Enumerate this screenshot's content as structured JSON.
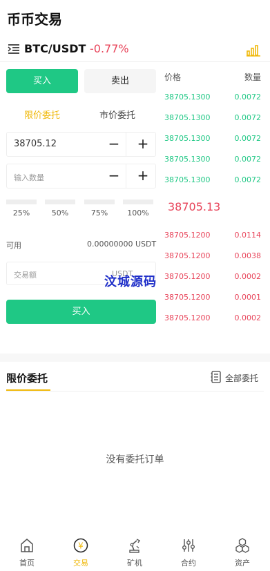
{
  "header": {
    "title": "币币交易"
  },
  "pair": {
    "name": "BTC/USDT",
    "change": "-0.77%",
    "menu_icon": "list-indent-icon",
    "chart_icon": "bar-chart-icon"
  },
  "side_tabs": {
    "buy": "买入",
    "sell": "卖出"
  },
  "order_types": {
    "limit": "限价委托",
    "market": "市价委托"
  },
  "form": {
    "price_value": "38705.12",
    "amount_placeholder": "输入数量",
    "minus": "−",
    "plus": "+",
    "percents": [
      "25%",
      "50%",
      "75%",
      "100%"
    ],
    "available_label": "可用",
    "available_value": "0.00000000 USDT",
    "total_placeholder": "交易额",
    "total_unit": "USDT",
    "submit": "买入"
  },
  "orderbook": {
    "header_price": "价格",
    "header_qty": "数量",
    "bids": [
      {
        "price": "38705.1300",
        "qty": "0.0072"
      },
      {
        "price": "38705.1300",
        "qty": "0.0072"
      },
      {
        "price": "38705.1300",
        "qty": "0.0072"
      },
      {
        "price": "38705.1300",
        "qty": "0.0072"
      },
      {
        "price": "38705.1300",
        "qty": "0.0072"
      }
    ],
    "last_price": "38705.13",
    "asks": [
      {
        "price": "38705.1200",
        "qty": "0.0114"
      },
      {
        "price": "38705.1200",
        "qty": "0.0038"
      },
      {
        "price": "38705.1200",
        "qty": "0.0002"
      },
      {
        "price": "38705.1200",
        "qty": "0.0001"
      },
      {
        "price": "38705.1200",
        "qty": "0.0002"
      }
    ]
  },
  "watermark": "汶城源码",
  "orders": {
    "title": "限价委托",
    "all_label": "全部委托",
    "empty": "没有委托订单"
  },
  "tabbar": [
    {
      "label": "首页",
      "icon": "home-icon"
    },
    {
      "label": "交易",
      "icon": "yuan-coin-icon",
      "active": true
    },
    {
      "label": "矿机",
      "icon": "robot-arm-icon"
    },
    {
      "label": "合约",
      "icon": "sliders-icon"
    },
    {
      "label": "资产",
      "icon": "cubes-icon"
    }
  ],
  "colors": {
    "accent_green": "#1fc885",
    "accent_red": "#e8445a",
    "accent_yellow": "#f0b90b",
    "watermark": "#1f2fc9"
  }
}
